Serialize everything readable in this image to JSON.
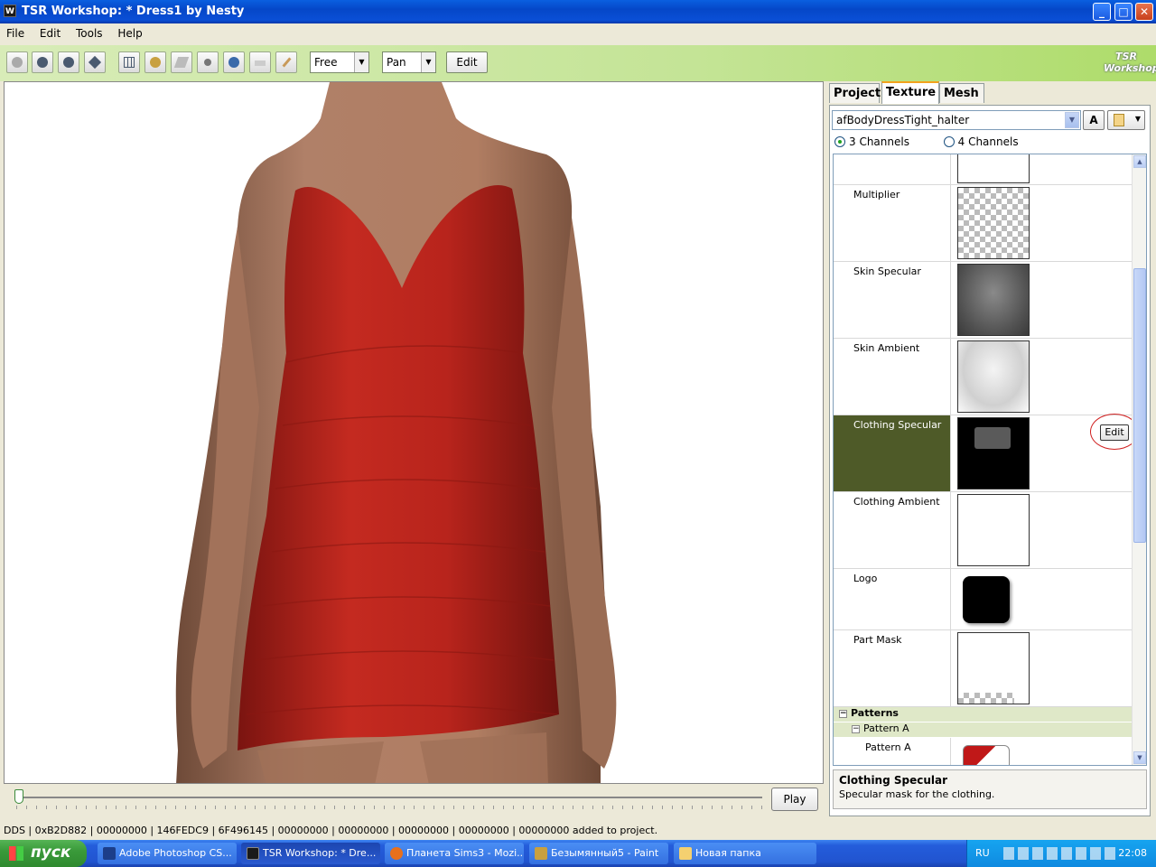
{
  "window": {
    "app_icon": "W",
    "title": "TSR Workshop: * Dress1 by Nesty",
    "minimize": "_",
    "maximize": "□",
    "close": "✕"
  },
  "menu": [
    "File",
    "Edit",
    "Tools",
    "Help"
  ],
  "toolbar": {
    "mode_select": "Free",
    "nav_select": "Pan",
    "edit_label": "Edit",
    "logo_text": "TSR Workshop"
  },
  "timeline": {
    "play_label": "Play",
    "position": 0
  },
  "panel": {
    "tabs": [
      {
        "label": "Project",
        "active": false
      },
      {
        "label": "Texture",
        "active": true
      },
      {
        "label": "Mesh",
        "active": false
      }
    ],
    "texture_select": "afBodyDressTight_halter",
    "a_button": "A",
    "channels": [
      {
        "label": "3 Channels",
        "selected": true
      },
      {
        "label": "4 Channels",
        "selected": false
      }
    ],
    "rows": [
      {
        "label": "Multiplier",
        "thumb": "checker"
      },
      {
        "label": "Skin Specular",
        "thumb": "gray"
      },
      {
        "label": "Skin Ambient",
        "thumb": "light"
      },
      {
        "label": "Clothing Specular",
        "thumb": "black",
        "selected": true,
        "edit": "Edit"
      },
      {
        "label": "Clothing Ambient",
        "thumb": "white"
      },
      {
        "label": "Logo",
        "thumb": "logo"
      },
      {
        "label": "Part Mask",
        "thumb": "white"
      }
    ],
    "groups": {
      "patterns": "Patterns",
      "pattern_a_group": "Pattern A",
      "pattern_a_item": "Pattern A"
    },
    "description": {
      "title": "Clothing Specular",
      "text": "Specular mask for the clothing."
    }
  },
  "status": "DDS | 0xB2D882 | 00000000 | 146FEDC9 | 6F496145 | 00000000 | 00000000 | 00000000 | 00000000 | 00000000 added to project.",
  "taskbar": {
    "start": "пуск",
    "tasks": [
      {
        "label": "Adobe Photoshop CS...",
        "icon_color": "#1c3e8a",
        "active": false
      },
      {
        "label": "TSR Workshop: * Dre...",
        "icon_color": "#1a1a1a",
        "active": true
      },
      {
        "label": "Планета Sims3 - Mozi...",
        "icon_color": "#e8701c",
        "active": false
      },
      {
        "label": "Безымянный5 - Paint",
        "icon_color": "#c8a040",
        "active": false
      },
      {
        "label": "Новая папка",
        "icon_color": "#f4d070",
        "active": false
      }
    ],
    "language": "RU",
    "clock": "22:08"
  },
  "colors": {
    "dress": "#b8241c",
    "skin": "#b07d62",
    "selected_row": "#4e5a28",
    "toolbar_green": "#aedc6a"
  }
}
